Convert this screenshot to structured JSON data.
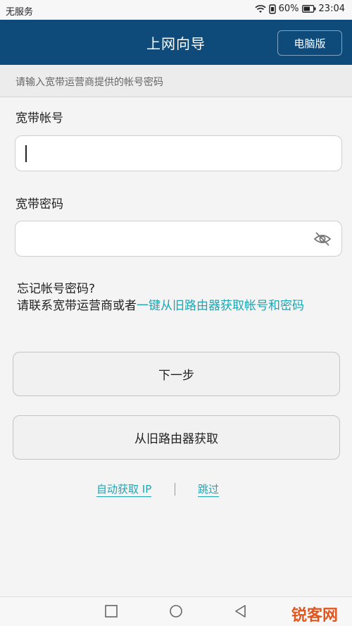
{
  "status_bar": {
    "carrier": "无服务",
    "battery": "60%",
    "time": "23:04"
  },
  "header": {
    "title": "上网向导",
    "pc_version_label": "电脑版"
  },
  "hint": "请输入宽带运营商提供的帐号密码",
  "account": {
    "label": "宽带帐号",
    "value": ""
  },
  "password": {
    "label": "宽带密码",
    "value": ""
  },
  "forgot": {
    "line1": "忘记帐号密码?",
    "line2_prefix": "请联系宽带运营商或者",
    "line2_link": "一键从旧路由器获取帐号和密码"
  },
  "buttons": {
    "next": "下一步",
    "from_old_router": "从旧路由器获取"
  },
  "bottom_links": {
    "auto_ip": "自动获取 IP",
    "separator": "|",
    "skip": "跳过"
  },
  "watermark": "锐客网",
  "colors": {
    "header_bg": "#0e4a7a",
    "link": "#1ea6b3",
    "watermark": "#e2551f"
  }
}
